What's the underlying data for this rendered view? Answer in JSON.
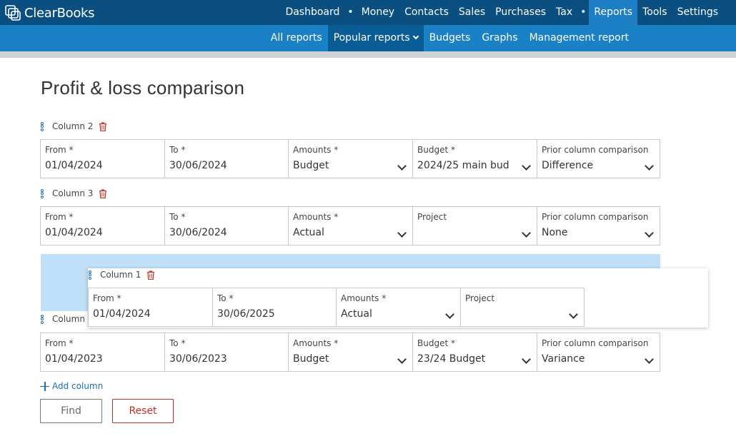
{
  "app": {
    "brand": "ClearBooks"
  },
  "topnav": {
    "items": [
      {
        "label": "Dashboard"
      },
      {
        "label": "Money"
      },
      {
        "label": "Contacts"
      },
      {
        "label": "Sales"
      },
      {
        "label": "Purchases"
      },
      {
        "label": "Tax"
      },
      {
        "label": "Reports",
        "active": true
      },
      {
        "label": "Tools"
      },
      {
        "label": "Settings"
      }
    ]
  },
  "subnav": {
    "items": [
      {
        "label": "All reports"
      },
      {
        "label": "Popular reports",
        "active": true
      },
      {
        "label": "Budgets"
      },
      {
        "label": "Graphs"
      },
      {
        "label": "Management report"
      }
    ]
  },
  "page": {
    "title": "Profit & loss comparison"
  },
  "columns": {
    "col2": {
      "title": "Column 2",
      "fields": [
        {
          "label": "From *",
          "value": "01/04/2024"
        },
        {
          "label": "To *",
          "value": "30/06/2024"
        },
        {
          "label": "Amounts *",
          "value": "Budget"
        },
        {
          "label": "Budget *",
          "value": "2024/25 main budget"
        },
        {
          "label": "Prior column comparison",
          "value": "Difference"
        }
      ]
    },
    "col3": {
      "title": "Column 3",
      "fields": [
        {
          "label": "From *",
          "value": "01/04/2024"
        },
        {
          "label": "To *",
          "value": "30/06/2024"
        },
        {
          "label": "Amounts *",
          "value": "Actual"
        },
        {
          "label": "Project",
          "value": ""
        },
        {
          "label": "Prior column comparison",
          "value": "None"
        }
      ]
    },
    "col1": {
      "title": "Column 1",
      "fields": [
        {
          "label": "From *",
          "value": "01/04/2024"
        },
        {
          "label": "To *",
          "value": "30/06/2025"
        },
        {
          "label": "Amounts *",
          "value": "Actual"
        },
        {
          "label": "Project",
          "value": ""
        }
      ]
    },
    "col4": {
      "title": "Column 4",
      "fields": [
        {
          "label": "From *",
          "value": "01/04/2023"
        },
        {
          "label": "To *",
          "value": "30/06/2023"
        },
        {
          "label": "Amounts *",
          "value": "Budget"
        },
        {
          "label": "Budget *",
          "value": "23/24 Budget"
        },
        {
          "label": "Prior column comparison",
          "value": "Variance"
        }
      ]
    }
  },
  "actions": {
    "add_column": "Add column",
    "find": "Find",
    "reset": "Reset"
  },
  "colors": {
    "topbar": "#0a4f80",
    "subbar": "#1a81c6",
    "active_tab": "#1f7fc4",
    "dropzone": "#bfe0f8",
    "link": "#1a6fb3",
    "danger": "#b8322d"
  }
}
